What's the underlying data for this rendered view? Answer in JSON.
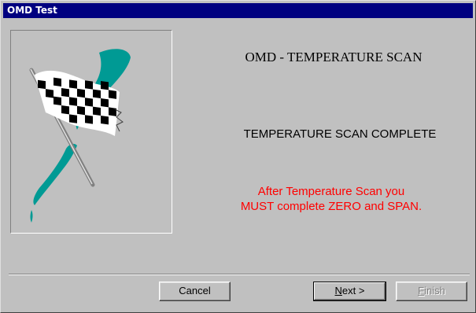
{
  "window": {
    "title": "OMD Test"
  },
  "main": {
    "heading": "OMD - TEMPERATURE SCAN",
    "status": "TEMPERATURE SCAN COMPLETE",
    "warning_line1": "After Temperature Scan you",
    "warning_line2": "MUST complete ZERO and SPAN."
  },
  "image": {
    "icon": "checkered-flag-icon",
    "colors": {
      "swoosh": "#009a94",
      "flag_dark": "#000000",
      "flag_light": "#ffffff",
      "pole": "#808080"
    }
  },
  "buttons": {
    "cancel_label": "Cancel",
    "next_mnemonic": "N",
    "next_rest": "ext >",
    "finish_mnemonic": "F",
    "finish_rest": "inish"
  },
  "colors": {
    "titlebar": "#000080",
    "face": "#c0c0c0",
    "warning_text": "#ff0000"
  }
}
